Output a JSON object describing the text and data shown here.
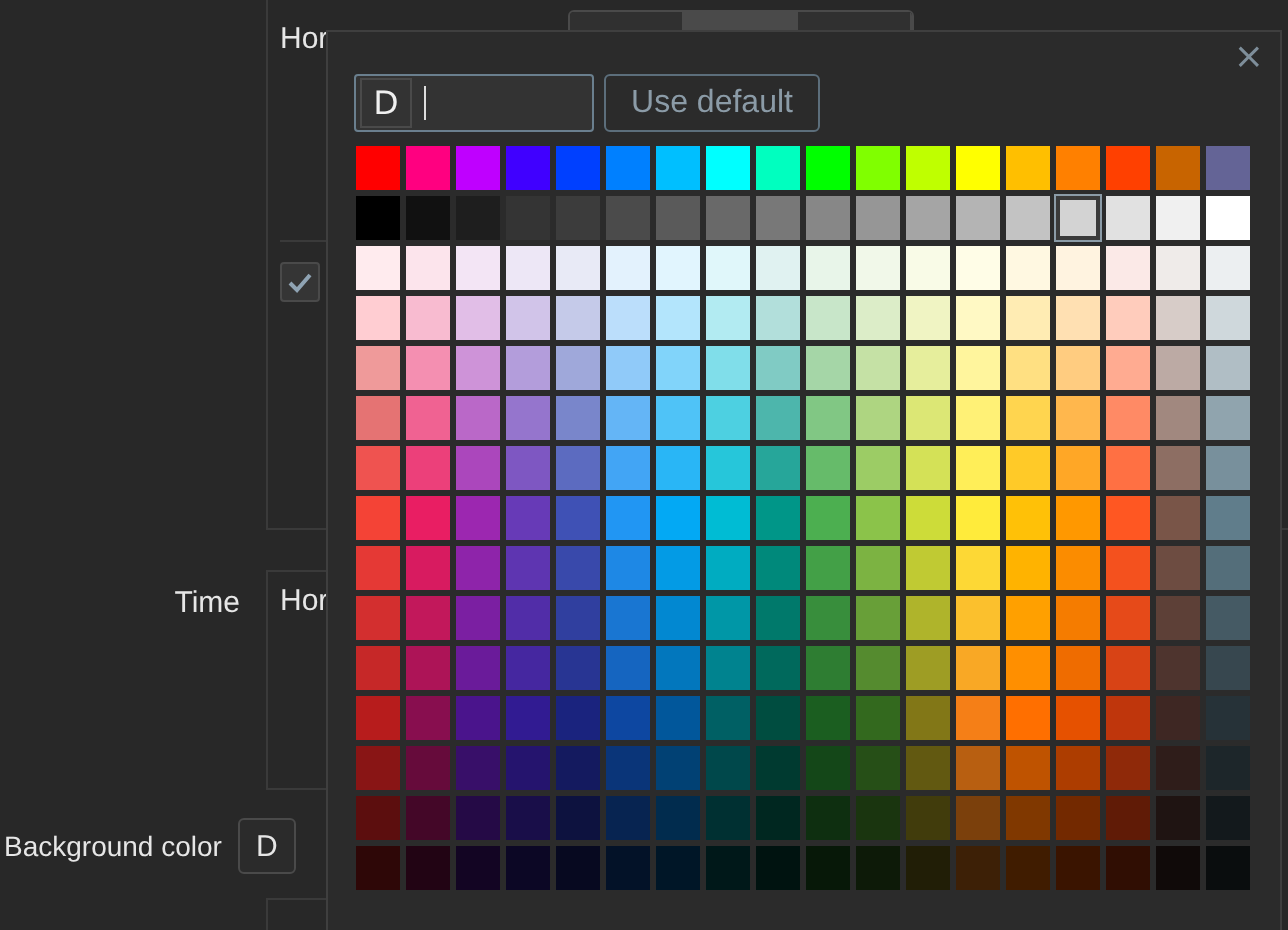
{
  "background_form": {
    "position_label": "Hor",
    "position_tabs": [
      {
        "selected": false
      },
      {
        "selected": true
      },
      {
        "selected": false
      }
    ],
    "option_checkbox": {
      "checked": true
    },
    "time": {
      "label": "Time",
      "position_label": "Hor"
    },
    "background_color": {
      "label": "Background color",
      "button": "D"
    }
  },
  "color_picker": {
    "close": "×",
    "prefix": "D",
    "use_default": "Use default",
    "swatch_rows": [
      [
        {
          "color": "#ff0000",
          "selected": false
        },
        {
          "color": "#ff0080",
          "selected": false
        },
        {
          "color": "#bf00ff",
          "selected": false
        },
        {
          "color": "#4000ff",
          "selected": false
        },
        {
          "color": "#0040ff",
          "selected": false
        },
        {
          "color": "#0080ff",
          "selected": false
        },
        {
          "color": "#00bfff",
          "selected": false
        },
        {
          "color": "#00ffff",
          "selected": false
        },
        {
          "color": "#00ffbf",
          "selected": false
        },
        {
          "color": "#00ff00",
          "selected": false
        },
        {
          "color": "#80ff00",
          "selected": false
        },
        {
          "color": "#bfff00",
          "selected": false
        },
        {
          "color": "#ffff00",
          "selected": false
        },
        {
          "color": "#ffbf00",
          "selected": false
        },
        {
          "color": "#ff8000",
          "selected": false
        },
        {
          "color": "#ff4000",
          "selected": false
        },
        {
          "color": "#c86400",
          "selected": false
        },
        {
          "color": "#646496",
          "selected": false
        }
      ],
      [
        {
          "color": "#000000",
          "selected": false
        },
        {
          "color": "#111111",
          "selected": false
        },
        {
          "color": "#1e1e1e",
          "selected": false
        },
        {
          "color": "#343434",
          "selected": false
        },
        {
          "color": "#3c3c3c",
          "selected": false
        },
        {
          "color": "#4b4b4b",
          "selected": false
        },
        {
          "color": "#5a5a5a",
          "selected": false
        },
        {
          "color": "#696969",
          "selected": false
        },
        {
          "color": "#787878",
          "selected": false
        },
        {
          "color": "#878787",
          "selected": false
        },
        {
          "color": "#969696",
          "selected": false
        },
        {
          "color": "#a5a5a5",
          "selected": false
        },
        {
          "color": "#b4b4b4",
          "selected": false
        },
        {
          "color": "#c3c3c3",
          "selected": false
        },
        {
          "color": "#d3d3d3",
          "selected": true
        },
        {
          "color": "#e1e1e1",
          "selected": false
        },
        {
          "color": "#f0f0f0",
          "selected": false
        },
        {
          "color": "#ffffff",
          "selected": false
        }
      ],
      [
        {
          "color": "#ffebee",
          "selected": false
        },
        {
          "color": "#fce4ec",
          "selected": false
        },
        {
          "color": "#f3e5f5",
          "selected": false
        },
        {
          "color": "#ede7f6",
          "selected": false
        },
        {
          "color": "#e8eaf6",
          "selected": false
        },
        {
          "color": "#e3f2fd",
          "selected": false
        },
        {
          "color": "#e1f5fe",
          "selected": false
        },
        {
          "color": "#e0f7fa",
          "selected": false
        },
        {
          "color": "#e0f2f1",
          "selected": false
        },
        {
          "color": "#e8f5e9",
          "selected": false
        },
        {
          "color": "#f1f8e9",
          "selected": false
        },
        {
          "color": "#f9fbe7",
          "selected": false
        },
        {
          "color": "#fffde7",
          "selected": false
        },
        {
          "color": "#fff8e1",
          "selected": false
        },
        {
          "color": "#fff3e0",
          "selected": false
        },
        {
          "color": "#fbe9e7",
          "selected": false
        },
        {
          "color": "#efebe9",
          "selected": false
        },
        {
          "color": "#eceff1",
          "selected": false
        }
      ],
      [
        {
          "color": "#ffcdd2",
          "selected": false
        },
        {
          "color": "#f8bbd0",
          "selected": false
        },
        {
          "color": "#e1bee7",
          "selected": false
        },
        {
          "color": "#d1c4e9",
          "selected": false
        },
        {
          "color": "#c5cae9",
          "selected": false
        },
        {
          "color": "#bbdefb",
          "selected": false
        },
        {
          "color": "#b3e5fc",
          "selected": false
        },
        {
          "color": "#b2ebf2",
          "selected": false
        },
        {
          "color": "#b2dfdb",
          "selected": false
        },
        {
          "color": "#c8e6c9",
          "selected": false
        },
        {
          "color": "#dcedc8",
          "selected": false
        },
        {
          "color": "#f0f4c3",
          "selected": false
        },
        {
          "color": "#fff9c4",
          "selected": false
        },
        {
          "color": "#ffecb3",
          "selected": false
        },
        {
          "color": "#ffe0b2",
          "selected": false
        },
        {
          "color": "#ffccbc",
          "selected": false
        },
        {
          "color": "#d7ccc8",
          "selected": false
        },
        {
          "color": "#cfd8dc",
          "selected": false
        }
      ],
      [
        {
          "color": "#ef9a9a",
          "selected": false
        },
        {
          "color": "#f48fb1",
          "selected": false
        },
        {
          "color": "#ce93d8",
          "selected": false
        },
        {
          "color": "#b39ddb",
          "selected": false
        },
        {
          "color": "#9fa8da",
          "selected": false
        },
        {
          "color": "#90caf9",
          "selected": false
        },
        {
          "color": "#81d4fa",
          "selected": false
        },
        {
          "color": "#80deea",
          "selected": false
        },
        {
          "color": "#80cbc4",
          "selected": false
        },
        {
          "color": "#a5d6a7",
          "selected": false
        },
        {
          "color": "#c5e1a5",
          "selected": false
        },
        {
          "color": "#e6ee9c",
          "selected": false
        },
        {
          "color": "#fff59d",
          "selected": false
        },
        {
          "color": "#ffe082",
          "selected": false
        },
        {
          "color": "#ffcc80",
          "selected": false
        },
        {
          "color": "#ffab91",
          "selected": false
        },
        {
          "color": "#bcaaa4",
          "selected": false
        },
        {
          "color": "#b0bec5",
          "selected": false
        }
      ],
      [
        {
          "color": "#e57373",
          "selected": false
        },
        {
          "color": "#f06292",
          "selected": false
        },
        {
          "color": "#ba68c8",
          "selected": false
        },
        {
          "color": "#9575cd",
          "selected": false
        },
        {
          "color": "#7986cb",
          "selected": false
        },
        {
          "color": "#64b5f6",
          "selected": false
        },
        {
          "color": "#4fc3f7",
          "selected": false
        },
        {
          "color": "#4dd0e1",
          "selected": false
        },
        {
          "color": "#4db6ac",
          "selected": false
        },
        {
          "color": "#81c784",
          "selected": false
        },
        {
          "color": "#aed581",
          "selected": false
        },
        {
          "color": "#dce775",
          "selected": false
        },
        {
          "color": "#fff176",
          "selected": false
        },
        {
          "color": "#ffd54f",
          "selected": false
        },
        {
          "color": "#ffb74d",
          "selected": false
        },
        {
          "color": "#ff8a65",
          "selected": false
        },
        {
          "color": "#a1887f",
          "selected": false
        },
        {
          "color": "#90a4ae",
          "selected": false
        }
      ],
      [
        {
          "color": "#ef5350",
          "selected": false
        },
        {
          "color": "#ec407a",
          "selected": false
        },
        {
          "color": "#ab47bc",
          "selected": false
        },
        {
          "color": "#7e57c2",
          "selected": false
        },
        {
          "color": "#5c6bc0",
          "selected": false
        },
        {
          "color": "#42a5f5",
          "selected": false
        },
        {
          "color": "#29b6f6",
          "selected": false
        },
        {
          "color": "#26c6da",
          "selected": false
        },
        {
          "color": "#26a69a",
          "selected": false
        },
        {
          "color": "#66bb6a",
          "selected": false
        },
        {
          "color": "#9ccc65",
          "selected": false
        },
        {
          "color": "#d4e157",
          "selected": false
        },
        {
          "color": "#ffee58",
          "selected": false
        },
        {
          "color": "#ffca28",
          "selected": false
        },
        {
          "color": "#ffa726",
          "selected": false
        },
        {
          "color": "#ff7043",
          "selected": false
        },
        {
          "color": "#8d6e63",
          "selected": false
        },
        {
          "color": "#78909c",
          "selected": false
        }
      ],
      [
        {
          "color": "#f44336",
          "selected": false
        },
        {
          "color": "#e91e63",
          "selected": false
        },
        {
          "color": "#9c27b0",
          "selected": false
        },
        {
          "color": "#673ab7",
          "selected": false
        },
        {
          "color": "#3f51b5",
          "selected": false
        },
        {
          "color": "#2196f3",
          "selected": false
        },
        {
          "color": "#03a9f4",
          "selected": false
        },
        {
          "color": "#00bcd4",
          "selected": false
        },
        {
          "color": "#009688",
          "selected": false
        },
        {
          "color": "#4caf50",
          "selected": false
        },
        {
          "color": "#8bc34a",
          "selected": false
        },
        {
          "color": "#cddc39",
          "selected": false
        },
        {
          "color": "#ffeb3b",
          "selected": false
        },
        {
          "color": "#ffc107",
          "selected": false
        },
        {
          "color": "#ff9800",
          "selected": false
        },
        {
          "color": "#ff5722",
          "selected": false
        },
        {
          "color": "#795548",
          "selected": false
        },
        {
          "color": "#607d8b",
          "selected": false
        }
      ],
      [
        {
          "color": "#e53935",
          "selected": false
        },
        {
          "color": "#d81b60",
          "selected": false
        },
        {
          "color": "#8e24aa",
          "selected": false
        },
        {
          "color": "#5e35b1",
          "selected": false
        },
        {
          "color": "#3949ab",
          "selected": false
        },
        {
          "color": "#1e88e5",
          "selected": false
        },
        {
          "color": "#039be5",
          "selected": false
        },
        {
          "color": "#00acc1",
          "selected": false
        },
        {
          "color": "#00897b",
          "selected": false
        },
        {
          "color": "#43a047",
          "selected": false
        },
        {
          "color": "#7cb342",
          "selected": false
        },
        {
          "color": "#c0ca33",
          "selected": false
        },
        {
          "color": "#fdd835",
          "selected": false
        },
        {
          "color": "#ffb300",
          "selected": false
        },
        {
          "color": "#fb8c00",
          "selected": false
        },
        {
          "color": "#f4511e",
          "selected": false
        },
        {
          "color": "#6d4c41",
          "selected": false
        },
        {
          "color": "#546e7a",
          "selected": false
        }
      ],
      [
        {
          "color": "#d32f2f",
          "selected": false
        },
        {
          "color": "#c2185b",
          "selected": false
        },
        {
          "color": "#7b1fa2",
          "selected": false
        },
        {
          "color": "#512da8",
          "selected": false
        },
        {
          "color": "#303f9f",
          "selected": false
        },
        {
          "color": "#1976d2",
          "selected": false
        },
        {
          "color": "#0288d1",
          "selected": false
        },
        {
          "color": "#0097a7",
          "selected": false
        },
        {
          "color": "#00796b",
          "selected": false
        },
        {
          "color": "#388e3c",
          "selected": false
        },
        {
          "color": "#689f38",
          "selected": false
        },
        {
          "color": "#afb42b",
          "selected": false
        },
        {
          "color": "#fbc02d",
          "selected": false
        },
        {
          "color": "#ffa000",
          "selected": false
        },
        {
          "color": "#f57c00",
          "selected": false
        },
        {
          "color": "#e64a19",
          "selected": false
        },
        {
          "color": "#5d4037",
          "selected": false
        },
        {
          "color": "#455a64",
          "selected": false
        }
      ],
      [
        {
          "color": "#c62828",
          "selected": false
        },
        {
          "color": "#ad1457",
          "selected": false
        },
        {
          "color": "#6a1b9a",
          "selected": false
        },
        {
          "color": "#4527a0",
          "selected": false
        },
        {
          "color": "#283593",
          "selected": false
        },
        {
          "color": "#1565c0",
          "selected": false
        },
        {
          "color": "#0277bd",
          "selected": false
        },
        {
          "color": "#00838f",
          "selected": false
        },
        {
          "color": "#00695c",
          "selected": false
        },
        {
          "color": "#2e7d32",
          "selected": false
        },
        {
          "color": "#558b2f",
          "selected": false
        },
        {
          "color": "#9e9d24",
          "selected": false
        },
        {
          "color": "#f9a825",
          "selected": false
        },
        {
          "color": "#ff8f00",
          "selected": false
        },
        {
          "color": "#ef6c00",
          "selected": false
        },
        {
          "color": "#d84315",
          "selected": false
        },
        {
          "color": "#4e342e",
          "selected": false
        },
        {
          "color": "#37474f",
          "selected": false
        }
      ],
      [
        {
          "color": "#b71c1c",
          "selected": false
        },
        {
          "color": "#880e4f",
          "selected": false
        },
        {
          "color": "#4a148c",
          "selected": false
        },
        {
          "color": "#311b92",
          "selected": false
        },
        {
          "color": "#1a237e",
          "selected": false
        },
        {
          "color": "#0d47a1",
          "selected": false
        },
        {
          "color": "#01579b",
          "selected": false
        },
        {
          "color": "#006064",
          "selected": false
        },
        {
          "color": "#004d40",
          "selected": false
        },
        {
          "color": "#1b5e20",
          "selected": false
        },
        {
          "color": "#33691e",
          "selected": false
        },
        {
          "color": "#827717",
          "selected": false
        },
        {
          "color": "#f57f17",
          "selected": false
        },
        {
          "color": "#ff6f00",
          "selected": false
        },
        {
          "color": "#e65100",
          "selected": false
        },
        {
          "color": "#bf360c",
          "selected": false
        },
        {
          "color": "#3e2723",
          "selected": false
        },
        {
          "color": "#263238",
          "selected": false
        }
      ],
      [
        {
          "color": "#891515",
          "selected": false
        },
        {
          "color": "#660b3b",
          "selected": false
        },
        {
          "color": "#380f69",
          "selected": false
        },
        {
          "color": "#25146e",
          "selected": false
        },
        {
          "color": "#141a5f",
          "selected": false
        },
        {
          "color": "#0a3579",
          "selected": false
        },
        {
          "color": "#014174",
          "selected": false
        },
        {
          "color": "#00484b",
          "selected": false
        },
        {
          "color": "#003a30",
          "selected": false
        },
        {
          "color": "#144718",
          "selected": false
        },
        {
          "color": "#264f17",
          "selected": false
        },
        {
          "color": "#625911",
          "selected": false
        },
        {
          "color": "#b85f11",
          "selected": false
        },
        {
          "color": "#bf5300",
          "selected": false
        },
        {
          "color": "#ad3d00",
          "selected": false
        },
        {
          "color": "#8f2909",
          "selected": false
        },
        {
          "color": "#2f1d1a",
          "selected": false
        },
        {
          "color": "#1d262a",
          "selected": false
        }
      ],
      [
        {
          "color": "#5c0e0e",
          "selected": false
        },
        {
          "color": "#440728",
          "selected": false
        },
        {
          "color": "#250a46",
          "selected": false
        },
        {
          "color": "#190e49",
          "selected": false
        },
        {
          "color": "#0d123f",
          "selected": false
        },
        {
          "color": "#072451",
          "selected": false
        },
        {
          "color": "#012c4e",
          "selected": false
        },
        {
          "color": "#003032",
          "selected": false
        },
        {
          "color": "#002720",
          "selected": false
        },
        {
          "color": "#0e2f10",
          "selected": false
        },
        {
          "color": "#1a350f",
          "selected": false
        },
        {
          "color": "#413c0c",
          "selected": false
        },
        {
          "color": "#7b400c",
          "selected": false
        },
        {
          "color": "#803800",
          "selected": false
        },
        {
          "color": "#732900",
          "selected": false
        },
        {
          "color": "#601b06",
          "selected": false
        },
        {
          "color": "#1f1412",
          "selected": false
        },
        {
          "color": "#13191c",
          "selected": false
        }
      ],
      [
        {
          "color": "#2e0707",
          "selected": false
        },
        {
          "color": "#220414",
          "selected": false
        },
        {
          "color": "#130523",
          "selected": false
        },
        {
          "color": "#0c0725",
          "selected": false
        },
        {
          "color": "#070920",
          "selected": false
        },
        {
          "color": "#031228",
          "selected": false
        },
        {
          "color": "#001627",
          "selected": false
        },
        {
          "color": "#001819",
          "selected": false
        },
        {
          "color": "#001310",
          "selected": false
        },
        {
          "color": "#071808",
          "selected": false
        },
        {
          "color": "#0d1a08",
          "selected": false
        },
        {
          "color": "#211e06",
          "selected": false
        },
        {
          "color": "#3d2006",
          "selected": false
        },
        {
          "color": "#401c00",
          "selected": false
        },
        {
          "color": "#3a1400",
          "selected": false
        },
        {
          "color": "#300e03",
          "selected": false
        },
        {
          "color": "#100a09",
          "selected": false
        },
        {
          "color": "#0a0d0e",
          "selected": false
        }
      ]
    ]
  }
}
